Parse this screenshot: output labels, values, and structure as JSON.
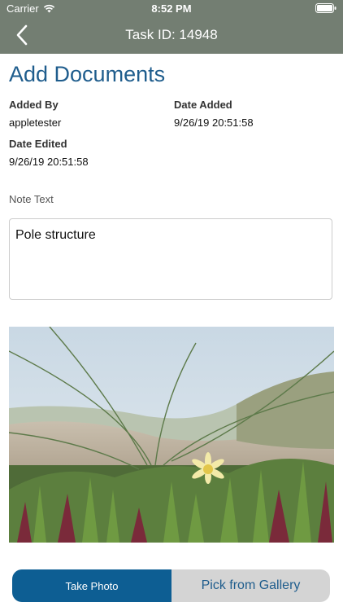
{
  "status": {
    "carrier": "Carrier",
    "time": "8:52 PM"
  },
  "nav": {
    "title": "Task ID: 14948"
  },
  "page": {
    "title": "Add Documents"
  },
  "fields": {
    "added_by_label": "Added By",
    "added_by_value": "appletester",
    "date_added_label": "Date Added",
    "date_added_value": "9/26/19 20:51:58",
    "date_edited_label": "Date Edited",
    "date_edited_value": "9/26/19 20:51:58"
  },
  "note": {
    "label": "Note Text",
    "value": "Pole structure"
  },
  "photo": {
    "subject": "ice plant flower in dune grass"
  },
  "buttons": {
    "take_photo": "Take Photo",
    "pick_gallery": "Pick from Gallery"
  },
  "colors": {
    "nav_bg": "#737e72",
    "accent": "#0d5e93",
    "title": "#1f5d8d"
  }
}
